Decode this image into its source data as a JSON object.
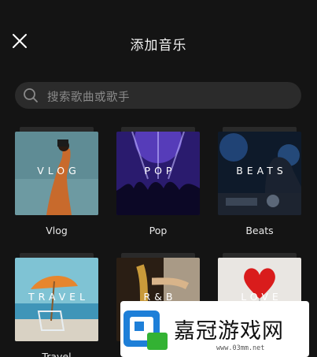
{
  "header": {
    "title": "添加音乐"
  },
  "search": {
    "placeholder": "搜索歌曲或歌手"
  },
  "categories": [
    {
      "label": "Vlog",
      "overlay": "VLOG"
    },
    {
      "label": "Pop",
      "overlay": "POP"
    },
    {
      "label": "Beats",
      "overlay": "BEATS"
    },
    {
      "label": "Travel",
      "overlay": "TRAVEL"
    },
    {
      "label": "",
      "overlay": "R&B"
    },
    {
      "label": "",
      "overlay": "LOVE"
    }
  ],
  "watermark": {
    "text": "嘉冠游戏网",
    "url": "www.03mm.net"
  },
  "colors": {
    "background": "#141414",
    "search_bg": "#2b2b2b",
    "placeholder": "#8a8a8a"
  }
}
